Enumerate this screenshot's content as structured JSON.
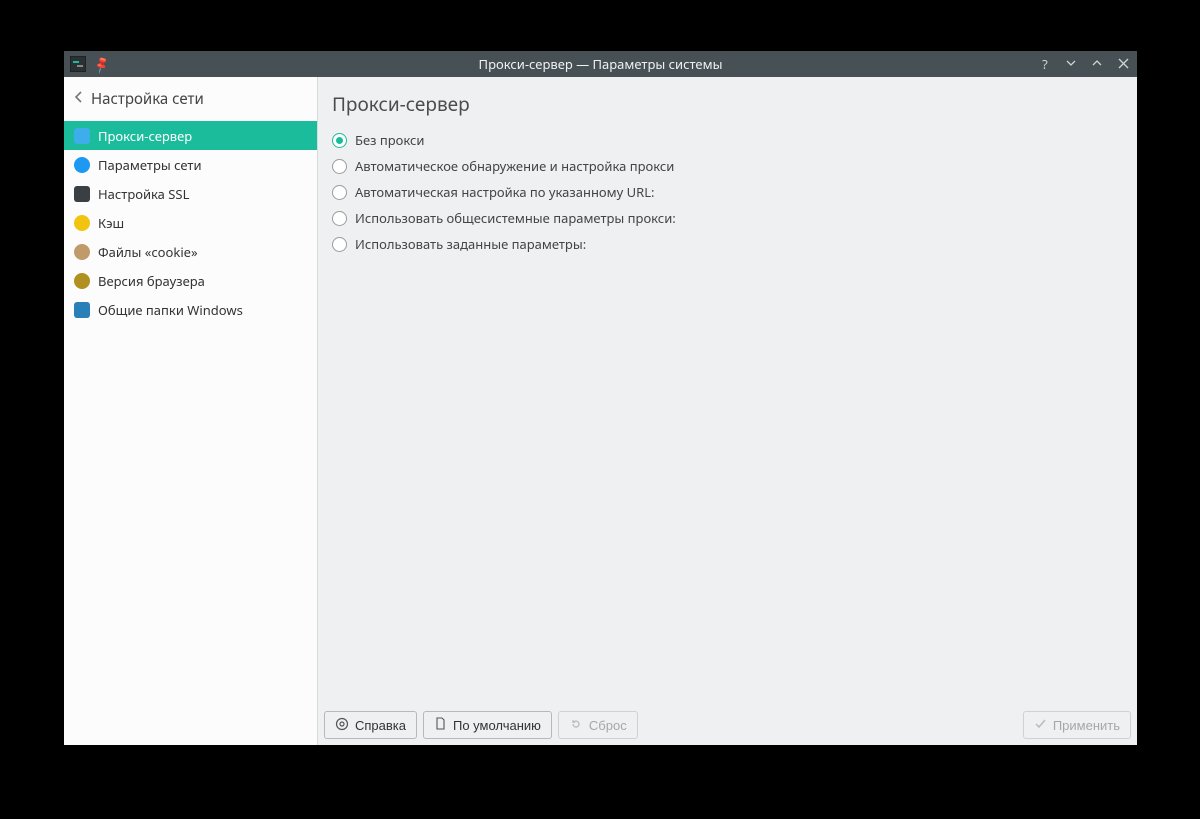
{
  "window": {
    "title": "Прокси-сервер — Параметры системы"
  },
  "sidebar": {
    "back_label": "Настройка сети",
    "items": [
      {
        "label": "Прокси-сервер"
      },
      {
        "label": "Параметры сети"
      },
      {
        "label": "Настройка SSL"
      },
      {
        "label": "Кэш"
      },
      {
        "label": "Файлы «cookie»"
      },
      {
        "label": "Версия браузера"
      },
      {
        "label": "Общие папки Windows"
      }
    ]
  },
  "main": {
    "heading": "Прокси-сервер",
    "options": [
      "Без прокси",
      "Автоматическое обнаружение и настройка прокси",
      "Автоматическая настройка по указанному URL:",
      "Использовать общесистемные параметры прокси:",
      "Использовать заданные параметры:"
    ],
    "selected_option": 0
  },
  "footer": {
    "help": "Справка",
    "defaults": "По умолчанию",
    "reset": "Сброс",
    "apply": "Применить"
  }
}
